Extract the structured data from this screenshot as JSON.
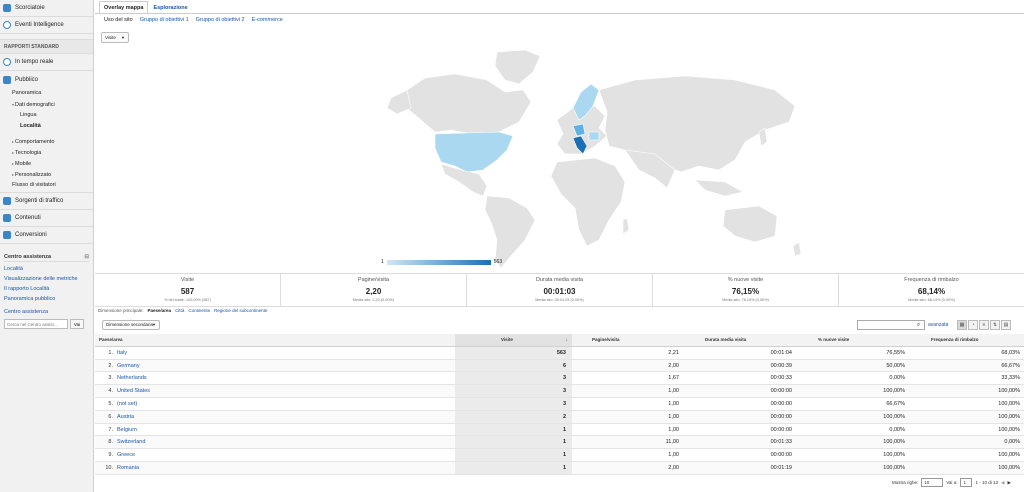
{
  "sidebar": {
    "top_items": [
      {
        "label": "Scorciatoie",
        "icon": "shortcuts-icon"
      },
      {
        "label": "Eventi Intelligence",
        "icon": "lightbulb-icon"
      }
    ],
    "section_label": "RAPPORTI STANDARD",
    "realtime": "In tempo reale",
    "audience": "Pubblico",
    "audience_children": {
      "overview": "Panoramica",
      "demographics": "Dati demografici",
      "language": "Lingua",
      "location": "Località",
      "behavior": "Comportamento",
      "technology": "Tecnologia",
      "mobile": "Mobile",
      "custom": "Personalizzato",
      "flow": "Flusso di visitatori"
    },
    "bottom_items": [
      {
        "label": "Sorgenti di traffico",
        "icon": "traffic-sources-icon"
      },
      {
        "label": "Contenuti",
        "icon": "content-icon"
      },
      {
        "label": "Conversioni",
        "icon": "conversions-icon"
      }
    ],
    "help": {
      "title": "Centro assistenza",
      "close": "⊟",
      "links": [
        "Località",
        "Visualizzazione delle metriche",
        "Il rapporto Località",
        "Panoramica pubblico"
      ],
      "center_link": "Centro assistenza",
      "search_placeholder": "Cerca nel Centro assist...",
      "search_button": "Vai"
    }
  },
  "tabs": [
    "Overlay mappa",
    "Esplorazione"
  ],
  "subtabs": [
    "Uso del sito",
    "Gruppo di obiettivi 1",
    "Gruppo di obiettivi 2",
    "E-commerce"
  ],
  "metric_select": "Visite",
  "legend": {
    "min": "1",
    "max": "563"
  },
  "map_colors": {
    "land": "#e2e2e2",
    "light": "#a9d8f0",
    "mid": "#5fb2e3",
    "dark": "#1b6fb6",
    "border": "#ffffff"
  },
  "scorecards": [
    {
      "label": "Visite",
      "value": "587",
      "sub": "% del totale: 100,00% (587)"
    },
    {
      "label": "Pagine/visita",
      "value": "2,20",
      "sub": "Media sito: 2,20 (0,00%)"
    },
    {
      "label": "Durata media visita",
      "value": "00:01:03",
      "sub": "Media sito: 00:01:03 (0,00%)"
    },
    {
      "label": "% nuove visite",
      "value": "76,15%",
      "sub": "Media sito: 76,15% (0,00%)"
    },
    {
      "label": "Frequenza di rimbalzo",
      "value": "68,14%",
      "sub": "Media sito: 68,14% (0,00%)"
    }
  ],
  "dimension_bar": {
    "label": "Dimensione principale:",
    "active": "Paese/area",
    "links": [
      "Città",
      "Continente",
      "Regione del subcontinente"
    ]
  },
  "secondary_dimension": "Dimensione secondaria",
  "advanced_link": "avanzata",
  "table": {
    "headers": {
      "country": "Paese/area",
      "visits": "Visite",
      "sort_icon": "↓",
      "ppv": "Pagine/visita",
      "duration": "Durata media visita",
      "new": "% nuove visite",
      "bounce": "Frequenza di rimbalzo"
    },
    "rows": [
      {
        "n": "1.",
        "country": "Italy",
        "visits": "563",
        "ppv": "2,21",
        "dur": "00:01:04",
        "new": "76,55%",
        "bounce": "68,03%"
      },
      {
        "n": "2.",
        "country": "Germany",
        "visits": "6",
        "ppv": "2,00",
        "dur": "00:00:39",
        "new": "50,00%",
        "bounce": "66,67%"
      },
      {
        "n": "3.",
        "country": "Netherlands",
        "visits": "3",
        "ppv": "1,67",
        "dur": "00:00:33",
        "new": "0,00%",
        "bounce": "33,33%"
      },
      {
        "n": "4.",
        "country": "United States",
        "visits": "3",
        "ppv": "1,00",
        "dur": "00:00:00",
        "new": "100,00%",
        "bounce": "100,00%"
      },
      {
        "n": "5.",
        "country": "(not set)",
        "visits": "3",
        "ppv": "1,00",
        "dur": "00:00:00",
        "new": "66,67%",
        "bounce": "100,00%"
      },
      {
        "n": "6.",
        "country": "Austria",
        "visits": "2",
        "ppv": "1,00",
        "dur": "00:00:00",
        "new": "100,00%",
        "bounce": "100,00%"
      },
      {
        "n": "7.",
        "country": "Belgium",
        "visits": "1",
        "ppv": "1,00",
        "dur": "00:00:00",
        "new": "0,00%",
        "bounce": "100,00%"
      },
      {
        "n": "8.",
        "country": "Switzerland",
        "visits": "1",
        "ppv": "11,00",
        "dur": "00:01:33",
        "new": "100,00%",
        "bounce": "0,00%"
      },
      {
        "n": "9.",
        "country": "Greece",
        "visits": "1",
        "ppv": "1,00",
        "dur": "00:00:00",
        "new": "100,00%",
        "bounce": "100,00%"
      },
      {
        "n": "10.",
        "country": "Romania",
        "visits": "1",
        "ppv": "2,00",
        "dur": "00:01:19",
        "new": "100,00%",
        "bounce": "100,00%"
      }
    ]
  },
  "pager": {
    "rows_label": "Mostra righe:",
    "rows_value": "10",
    "goto_label": "Vai a:",
    "goto_value": "1",
    "range": "1 - 10 di 13"
  }
}
